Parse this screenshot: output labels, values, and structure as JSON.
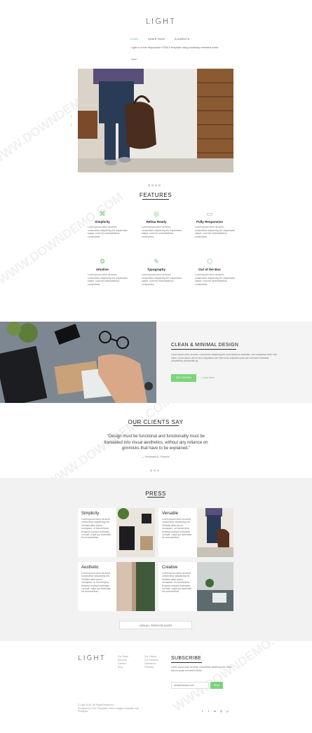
{
  "header": {
    "logo": "LIGHT",
    "nav": [
      "Home",
      "Inner Page",
      "Elements"
    ],
    "tagline": "Light is a free responsive HTML5 template using bootstrap released under"
  },
  "hero": {
    "dots": 4
  },
  "features": {
    "title": "FEATURES",
    "items": [
      {
        "title": "Simplicity",
        "icon": "shuffle-icon",
        "glyph": "⌘",
        "desc": "Lorem ipsum dolor sit amet, consectetur adipiscing elit. Aspernatur saepe, sunt est necessitatibus consectetur."
      },
      {
        "title": "Retina Ready",
        "icon": "eye-icon",
        "glyph": "◎",
        "desc": "Lorem ipsum dolor sit amet, consectetur adipiscing elit. Aspernatur saepe, sunt est necessitatibus consectetur."
      },
      {
        "title": "Fully Responsive",
        "icon": "monitor-icon",
        "glyph": "▭",
        "desc": "Lorem ipsum dolor sit amet, consectetur adipiscing elit. Aspernatur saepe, sunt est necessitatibus consectetur."
      },
      {
        "title": "Intuitive",
        "icon": "gear-icon",
        "glyph": "⚙",
        "desc": "Lorem ipsum dolor sit amet, consectetur adipiscing elit. Aspernatur saepe, sunt est necessitatibus consectetur."
      },
      {
        "title": "Typography",
        "icon": "pencil-icon",
        "glyph": "✎",
        "desc": "Lorem ipsum dolor sit amet, consectetur adipiscing elit. Aspernatur saepe, sunt est necessitatibus consectetur."
      },
      {
        "title": "Out of the Box",
        "icon": "cube-icon",
        "glyph": "⬡",
        "desc": "Lorem ipsum dolor sit amet, consectetur adipiscing elit. Aspernatur saepe, sunt est necessitatibus consectetur."
      }
    ]
  },
  "about": {
    "title": "CLEAN & MINIMAL DESIGN",
    "text": "Lorem ipsum dolor sit amet, consectetur adipiscing elit, quia laboribus molestiae, sed voluptatum dolor sunt nobis. Lorem ipsum dolore sem voluptatum tum vitae sodu voluptate quas sunt commodi molestiae voluptatibus perspiciatis ad.",
    "primary_btn": "GET STARTED",
    "secondary_btn": "Learn More"
  },
  "clients": {
    "title": "OUR CLIENTS SAY",
    "quote": "“Design must be functional and functionality must be translated into visual aesthetics, without any reliance on gimmicks that have to be explained.”",
    "author": "— Ferdinand A. Porsche"
  },
  "press": {
    "title": "PRESS",
    "cards": [
      {
        "title": "Simplicity",
        "text": "Lorem ipsum dolor sit amet, consectetur adipisicing elit. Veritatis alias ipsum numquam, ut eveniet ipsa tempora suscipit molestias corrupti, culpa qui molestiae hic accusantium."
      },
      {
        "title": "Versatile",
        "text": "Lorem ipsum dolor sit amet, consectetur adipisicing elit. Veritatis alias ipsum numquam, ut eveniet ipsa tempora suscipit molestias corrupti, culpa qui molestiae hic accusantium."
      },
      {
        "title": "Aesthetic",
        "text": "Lorem ipsum dolor sit amet, consectetur adipisicing elit. Veritatis alias ipsum numquam, ut eveniet ipsa tempora suscipit molestias corrupti, culpa qui molestiae hic accusantium."
      },
      {
        "title": "Creative",
        "text": "Lorem ipsum dolor sit amet, consectetur adipisicing elit. Veritatis alias ipsum numquam, ut eveniet ipsa tempora suscipit molestias corrupti, culpa qui molestiae hic accusantium."
      }
    ],
    "button": "VIEW ALL PRESS RELEASES"
  },
  "footer": {
    "logo": "LIGHT",
    "col1": [
      "Our Team",
      "Services",
      "Careers",
      "Blog"
    ],
    "col2": [
      "Our Clients",
      "Our Partners",
      "Operations",
      "Features"
    ],
    "subscribe_title": "SUBSCRIBE",
    "subscribe_text": "Lorem ipsum dolor sit amet, consectetur adipiscing elit. Nulla dolores quasi et eveniet officiis.",
    "email_placeholder": "info@example.com",
    "send_btn": "Send",
    "copyright_1": "© Light 2016. All Rights Reserved.",
    "copyright_2": "Designed by Free Templates  Demo Images Unsplash and",
    "copyright_3": "Pinegrow"
  },
  "watermark": "WWW.DOWNDEMO.COM",
  "colors": {
    "accent": "#6cc36a",
    "text": "#222222",
    "muted": "#777777",
    "band": "#f4f4f4"
  }
}
